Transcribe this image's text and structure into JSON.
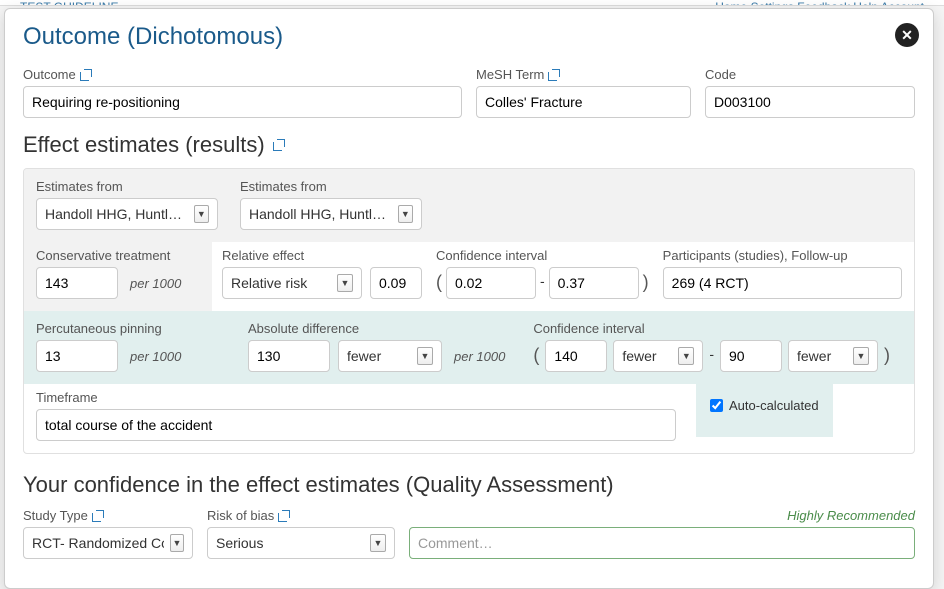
{
  "topnav": {
    "left": "TEST GUIDELINE",
    "right": "Home   Settings   Feedback   Help   Account"
  },
  "modal": {
    "title": "Outcome (Dichotomous)"
  },
  "outcome": {
    "outcome_label": "Outcome",
    "outcome_value": "Requiring re-positioning",
    "mesh_label": "MeSH Term",
    "mesh_value": "Colles' Fracture",
    "code_label": "Code",
    "code_value": "D003100"
  },
  "effects": {
    "heading": "Effect estimates (results)",
    "est_from_label": "Estimates from",
    "est_from_value": "Handoll HHG, Huntley J",
    "conservative_label": "Conservative treatment",
    "conservative_value": "143",
    "per1000": "per 1000",
    "relative_effect_label": "Relative effect",
    "relative_effect_type": "Relative risk",
    "relative_effect_value": "0.09",
    "ci_label": "Confidence interval",
    "ci_low": "0.02",
    "ci_high": "0.37",
    "participants_label": "Participants (studies), Follow-up",
    "participants_value": "269 (4 RCT)",
    "percutaneous_label": "Percutaneous pinning",
    "percutaneous_value": "13",
    "absdiff_label": "Absolute difference",
    "absdiff_value": "130",
    "absdiff_dir": "fewer",
    "ci2_low": "140",
    "ci2_low_dir": "fewer",
    "ci2_high": "90",
    "ci2_high_dir": "fewer",
    "auto_calc_label": "Auto-calculated",
    "timeframe_label": "Timeframe",
    "timeframe_value": "total course of the accident"
  },
  "quality": {
    "heading": "Your confidence in the effect estimates (Quality Assessment)",
    "study_type_label": "Study Type",
    "study_type_value": "RCT- Randomized Contr",
    "risk_label": "Risk of bias",
    "risk_value": "Serious",
    "comment_placeholder": "Comment…",
    "recommended": "Highly Recommended"
  }
}
